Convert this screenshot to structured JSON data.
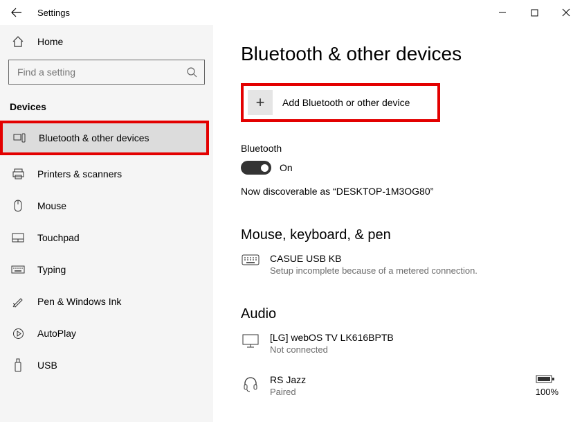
{
  "window": {
    "title": "Settings"
  },
  "sidebar": {
    "home": "Home",
    "search_placeholder": "Find a setting",
    "group": "Devices",
    "items": [
      {
        "label": "Bluetooth & other devices"
      },
      {
        "label": "Printers & scanners"
      },
      {
        "label": "Mouse"
      },
      {
        "label": "Touchpad"
      },
      {
        "label": "Typing"
      },
      {
        "label": "Pen & Windows Ink"
      },
      {
        "label": "AutoPlay"
      },
      {
        "label": "USB"
      }
    ]
  },
  "main": {
    "title": "Bluetooth & other devices",
    "add_label": "Add Bluetooth or other device",
    "bt_header": "Bluetooth",
    "bt_state": "On",
    "discover": "Now discoverable as “DESKTOP-1M3OG80”",
    "group_mkp": "Mouse, keyboard, & pen",
    "dev_kb": {
      "name": "CASUE USB KB",
      "sub": "Setup incomplete because of a metered connection."
    },
    "group_audio": "Audio",
    "dev_tv": {
      "name": "[LG] webOS TV LK616BPTB",
      "sub": "Not connected"
    },
    "dev_hp": {
      "name": "RS Jazz",
      "sub": "Paired",
      "batt": "100%"
    }
  }
}
